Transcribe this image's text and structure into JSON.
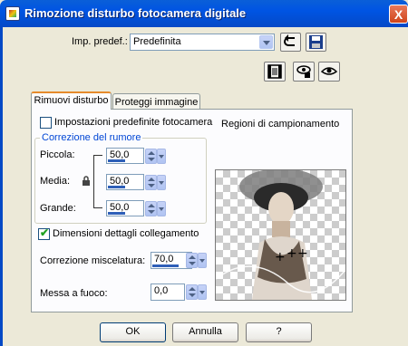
{
  "window": {
    "title": "Rimozione disturbo fotocamera digitale",
    "close_glyph": "X"
  },
  "preset": {
    "label": "Imp. predef.:",
    "value": "Predefinita"
  },
  "tabs": [
    {
      "label": "Rimuovi disturbo",
      "active": true
    },
    {
      "label": "Proteggi immagine",
      "active": false
    }
  ],
  "main": {
    "default_settings_checkbox": {
      "label": "Impostazioni predefinite fotocamera",
      "checked": false
    },
    "sampling_regions_label": "Regioni di campionamento",
    "noise_group": {
      "title": "Correzione del rumore",
      "rows": [
        {
          "label": "Piccola:",
          "value": "50,0",
          "fill": 0.5
        },
        {
          "label": "Media:",
          "value": "50,0",
          "fill": 0.5
        },
        {
          "label": "Grande:",
          "value": "50,0",
          "fill": 0.5
        }
      ]
    },
    "link_details_checkbox": {
      "label": "Dimensioni dettagli collegamento",
      "checked": true
    },
    "blend": {
      "label": "Correzione miscelatura:",
      "value": "70,0",
      "fill": 0.7
    },
    "sharpen": {
      "label": "Messa a fuoco:",
      "value": "0,0",
      "fill": 0.0
    }
  },
  "buttons": {
    "ok": "OK",
    "cancel": "Annulla",
    "help": "?"
  },
  "icons": {
    "reset": "undo-arrow-icon",
    "save": "floppy-disk-icon",
    "film": "film-strip-icon",
    "eye_toggle": "eye-preview-icon",
    "eye": "eye-icon",
    "lock": "lock-icon",
    "check": "✔"
  },
  "colors": {
    "titlebar": "#0054e3",
    "close": "#d0451b",
    "accent_group": "#0046d5",
    "tab_highlight": "#e68b2c",
    "bar": "#2e5fb8"
  }
}
